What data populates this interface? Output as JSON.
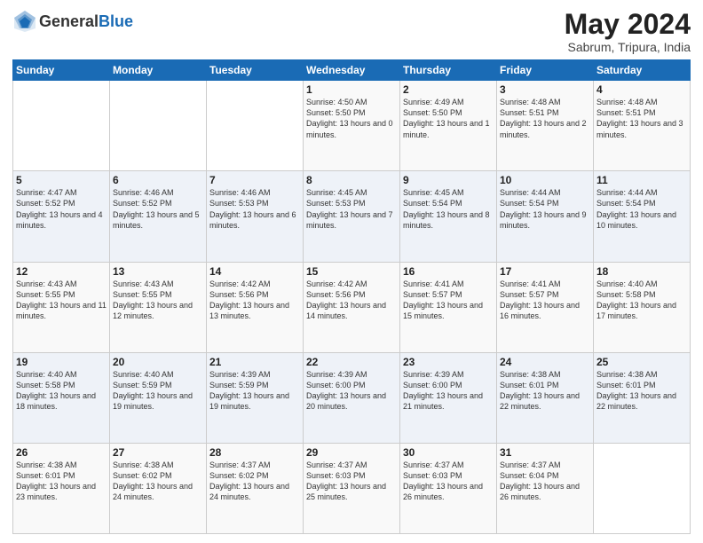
{
  "header": {
    "logo_general": "General",
    "logo_blue": "Blue",
    "month_year": "May 2024",
    "location": "Sabrum, Tripura, India"
  },
  "weekdays": [
    "Sunday",
    "Monday",
    "Tuesday",
    "Wednesday",
    "Thursday",
    "Friday",
    "Saturday"
  ],
  "weeks": [
    [
      {
        "day": "",
        "sunrise": "",
        "sunset": "",
        "daylight": ""
      },
      {
        "day": "",
        "sunrise": "",
        "sunset": "",
        "daylight": ""
      },
      {
        "day": "",
        "sunrise": "",
        "sunset": "",
        "daylight": ""
      },
      {
        "day": "1",
        "sunrise": "Sunrise: 4:50 AM",
        "sunset": "Sunset: 5:50 PM",
        "daylight": "Daylight: 13 hours and 0 minutes."
      },
      {
        "day": "2",
        "sunrise": "Sunrise: 4:49 AM",
        "sunset": "Sunset: 5:50 PM",
        "daylight": "Daylight: 13 hours and 1 minute."
      },
      {
        "day": "3",
        "sunrise": "Sunrise: 4:48 AM",
        "sunset": "Sunset: 5:51 PM",
        "daylight": "Daylight: 13 hours and 2 minutes."
      },
      {
        "day": "4",
        "sunrise": "Sunrise: 4:48 AM",
        "sunset": "Sunset: 5:51 PM",
        "daylight": "Daylight: 13 hours and 3 minutes."
      }
    ],
    [
      {
        "day": "5",
        "sunrise": "Sunrise: 4:47 AM",
        "sunset": "Sunset: 5:52 PM",
        "daylight": "Daylight: 13 hours and 4 minutes."
      },
      {
        "day": "6",
        "sunrise": "Sunrise: 4:46 AM",
        "sunset": "Sunset: 5:52 PM",
        "daylight": "Daylight: 13 hours and 5 minutes."
      },
      {
        "day": "7",
        "sunrise": "Sunrise: 4:46 AM",
        "sunset": "Sunset: 5:53 PM",
        "daylight": "Daylight: 13 hours and 6 minutes."
      },
      {
        "day": "8",
        "sunrise": "Sunrise: 4:45 AM",
        "sunset": "Sunset: 5:53 PM",
        "daylight": "Daylight: 13 hours and 7 minutes."
      },
      {
        "day": "9",
        "sunrise": "Sunrise: 4:45 AM",
        "sunset": "Sunset: 5:54 PM",
        "daylight": "Daylight: 13 hours and 8 minutes."
      },
      {
        "day": "10",
        "sunrise": "Sunrise: 4:44 AM",
        "sunset": "Sunset: 5:54 PM",
        "daylight": "Daylight: 13 hours and 9 minutes."
      },
      {
        "day": "11",
        "sunrise": "Sunrise: 4:44 AM",
        "sunset": "Sunset: 5:54 PM",
        "daylight": "Daylight: 13 hours and 10 minutes."
      }
    ],
    [
      {
        "day": "12",
        "sunrise": "Sunrise: 4:43 AM",
        "sunset": "Sunset: 5:55 PM",
        "daylight": "Daylight: 13 hours and 11 minutes."
      },
      {
        "day": "13",
        "sunrise": "Sunrise: 4:43 AM",
        "sunset": "Sunset: 5:55 PM",
        "daylight": "Daylight: 13 hours and 12 minutes."
      },
      {
        "day": "14",
        "sunrise": "Sunrise: 4:42 AM",
        "sunset": "Sunset: 5:56 PM",
        "daylight": "Daylight: 13 hours and 13 minutes."
      },
      {
        "day": "15",
        "sunrise": "Sunrise: 4:42 AM",
        "sunset": "Sunset: 5:56 PM",
        "daylight": "Daylight: 13 hours and 14 minutes."
      },
      {
        "day": "16",
        "sunrise": "Sunrise: 4:41 AM",
        "sunset": "Sunset: 5:57 PM",
        "daylight": "Daylight: 13 hours and 15 minutes."
      },
      {
        "day": "17",
        "sunrise": "Sunrise: 4:41 AM",
        "sunset": "Sunset: 5:57 PM",
        "daylight": "Daylight: 13 hours and 16 minutes."
      },
      {
        "day": "18",
        "sunrise": "Sunrise: 4:40 AM",
        "sunset": "Sunset: 5:58 PM",
        "daylight": "Daylight: 13 hours and 17 minutes."
      }
    ],
    [
      {
        "day": "19",
        "sunrise": "Sunrise: 4:40 AM",
        "sunset": "Sunset: 5:58 PM",
        "daylight": "Daylight: 13 hours and 18 minutes."
      },
      {
        "day": "20",
        "sunrise": "Sunrise: 4:40 AM",
        "sunset": "Sunset: 5:59 PM",
        "daylight": "Daylight: 13 hours and 19 minutes."
      },
      {
        "day": "21",
        "sunrise": "Sunrise: 4:39 AM",
        "sunset": "Sunset: 5:59 PM",
        "daylight": "Daylight: 13 hours and 19 minutes."
      },
      {
        "day": "22",
        "sunrise": "Sunrise: 4:39 AM",
        "sunset": "Sunset: 6:00 PM",
        "daylight": "Daylight: 13 hours and 20 minutes."
      },
      {
        "day": "23",
        "sunrise": "Sunrise: 4:39 AM",
        "sunset": "Sunset: 6:00 PM",
        "daylight": "Daylight: 13 hours and 21 minutes."
      },
      {
        "day": "24",
        "sunrise": "Sunrise: 4:38 AM",
        "sunset": "Sunset: 6:01 PM",
        "daylight": "Daylight: 13 hours and 22 minutes."
      },
      {
        "day": "25",
        "sunrise": "Sunrise: 4:38 AM",
        "sunset": "Sunset: 6:01 PM",
        "daylight": "Daylight: 13 hours and 22 minutes."
      }
    ],
    [
      {
        "day": "26",
        "sunrise": "Sunrise: 4:38 AM",
        "sunset": "Sunset: 6:01 PM",
        "daylight": "Daylight: 13 hours and 23 minutes."
      },
      {
        "day": "27",
        "sunrise": "Sunrise: 4:38 AM",
        "sunset": "Sunset: 6:02 PM",
        "daylight": "Daylight: 13 hours and 24 minutes."
      },
      {
        "day": "28",
        "sunrise": "Sunrise: 4:37 AM",
        "sunset": "Sunset: 6:02 PM",
        "daylight": "Daylight: 13 hours and 24 minutes."
      },
      {
        "day": "29",
        "sunrise": "Sunrise: 4:37 AM",
        "sunset": "Sunset: 6:03 PM",
        "daylight": "Daylight: 13 hours and 25 minutes."
      },
      {
        "day": "30",
        "sunrise": "Sunrise: 4:37 AM",
        "sunset": "Sunset: 6:03 PM",
        "daylight": "Daylight: 13 hours and 26 minutes."
      },
      {
        "day": "31",
        "sunrise": "Sunrise: 4:37 AM",
        "sunset": "Sunset: 6:04 PM",
        "daylight": "Daylight: 13 hours and 26 minutes."
      },
      {
        "day": "",
        "sunrise": "",
        "sunset": "",
        "daylight": ""
      }
    ]
  ]
}
